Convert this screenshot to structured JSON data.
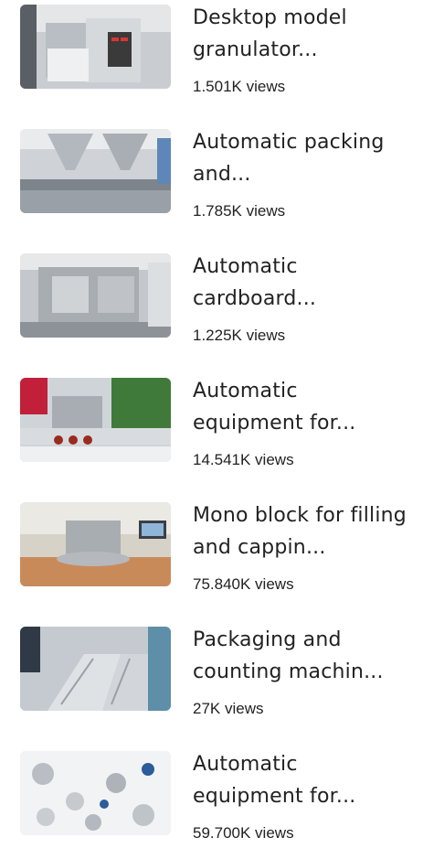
{
  "videos": [
    {
      "title": "Desktop model granulator...",
      "views": "1.501K views"
    },
    {
      "title": "Automatic packing and...",
      "views": "1.785K views"
    },
    {
      "title": "Automatic cardboard...",
      "views": "1.225K views"
    },
    {
      "title": "Automatic equipment for...",
      "views": "14.541K views"
    },
    {
      "title": "Mono block for filling and cappin...",
      "views": "75.840K views"
    },
    {
      "title": "Packaging and counting machin...",
      "views": "27K views"
    },
    {
      "title": "Automatic equipment for...",
      "views": "59.700K views"
    }
  ]
}
